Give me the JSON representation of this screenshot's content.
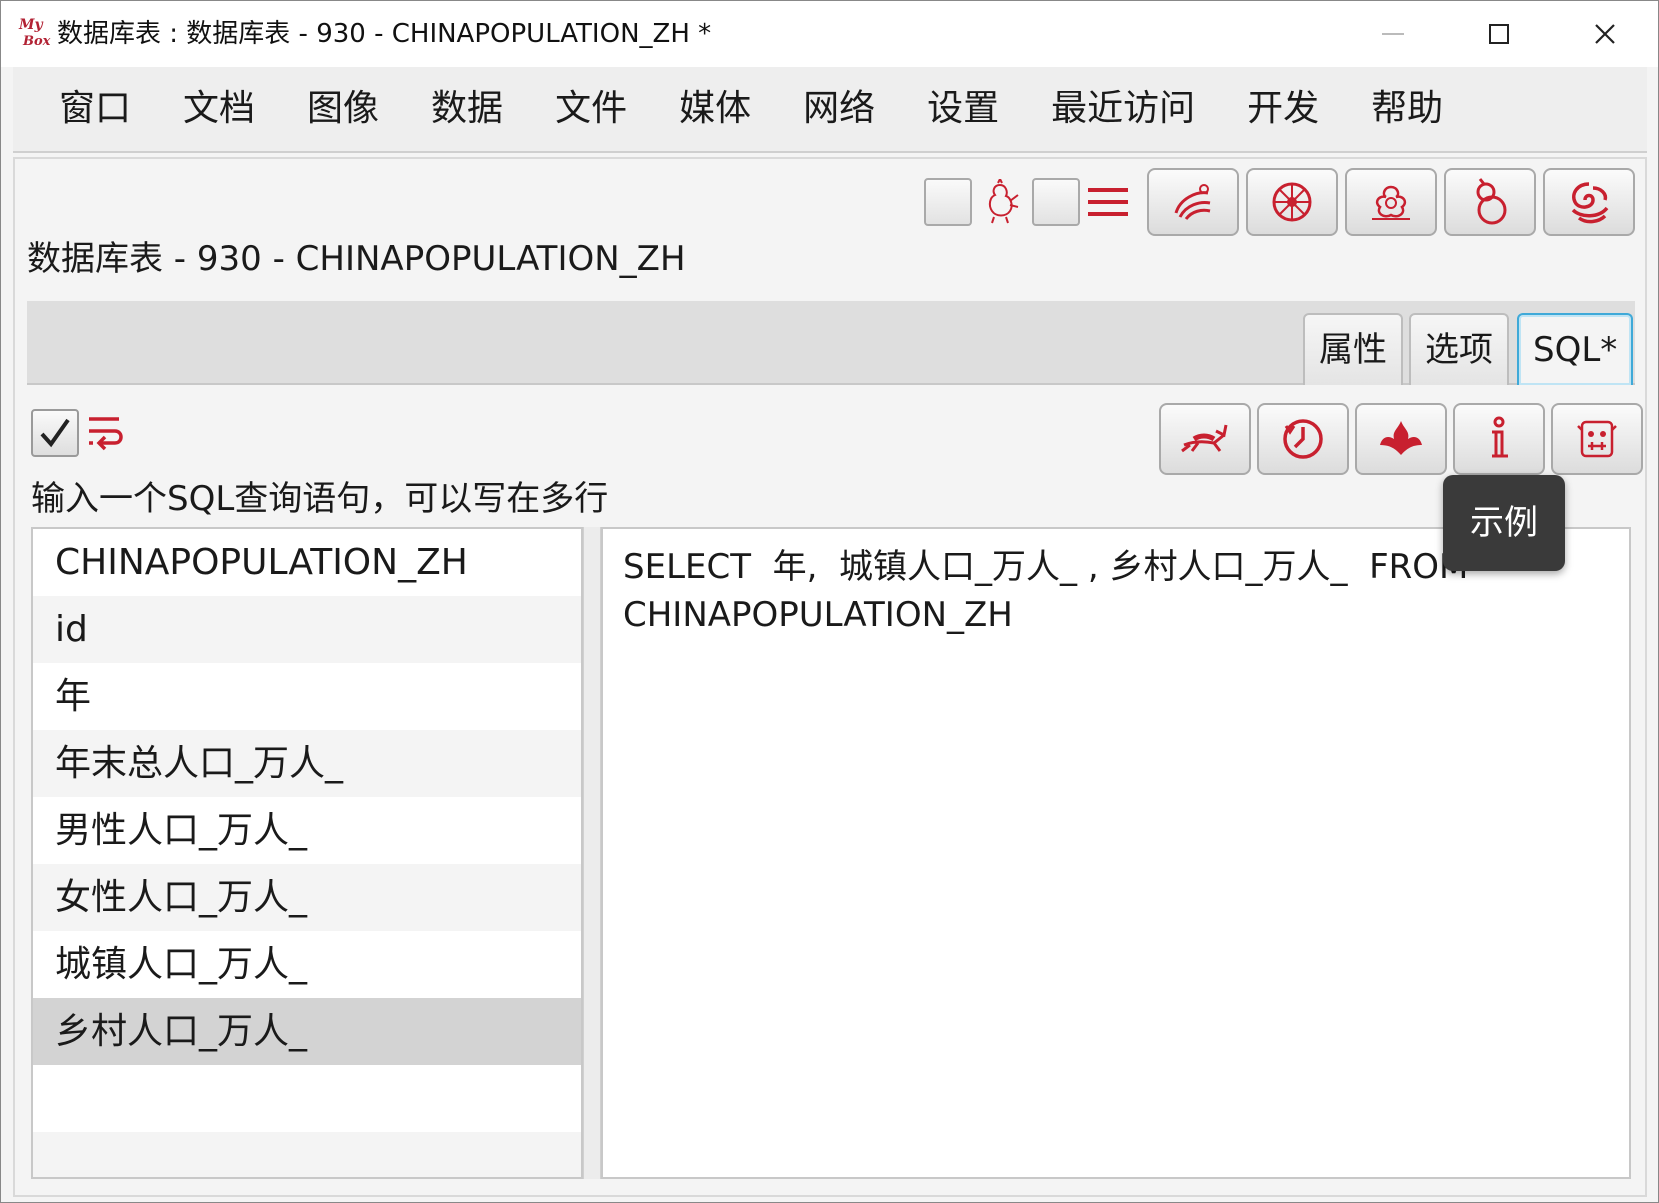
{
  "window": {
    "logo_text": "My Box",
    "title": "数据库表 : 数据库表 - 930 - CHINAPOPULATION_ZH *"
  },
  "menu": [
    "窗口",
    "文档",
    "图像",
    "数据",
    "文件",
    "媒体",
    "网络",
    "设置",
    "最近访问",
    "开发",
    "帮助"
  ],
  "panel": {
    "title": "数据库表 - 930 - CHINAPOPULATION_ZH"
  },
  "tabs": {
    "properties": "属性",
    "options": "选项",
    "sql": "SQL*"
  },
  "sql": {
    "prompt": "输入一个SQL查询语句，可以写在多行",
    "query": "SELECT  年,  城镇人口_万人_ , 乡村人口_万人_  FROM\nCHINAPOPULATION_ZH",
    "tooltip": "示例",
    "columns": [
      "CHINAPOPULATION_ZH",
      "id",
      "年",
      "年末总人口_万人_",
      "男性人口_万人_",
      "女性人口_万人_",
      "城镇人口_万人_",
      "乡村人口_万人_"
    ],
    "selected_column": "乡村人口_万人_"
  },
  "colors": {
    "accent": "#c8202f",
    "tab_active_border": "#3fa9d8",
    "tooltip_bg": "#3a3a3a"
  },
  "icons": {
    "top_toolbar": [
      "rooster-icon",
      "menu-lines-icon",
      "swirl-icon",
      "lotus-wheel-icon",
      "peony-icon",
      "gourd-icon",
      "cloud-swirl-icon"
    ],
    "sql_actions": [
      "deer-icon",
      "history-clock-icon",
      "flame-icon",
      "info-icon",
      "totem-icon"
    ]
  }
}
